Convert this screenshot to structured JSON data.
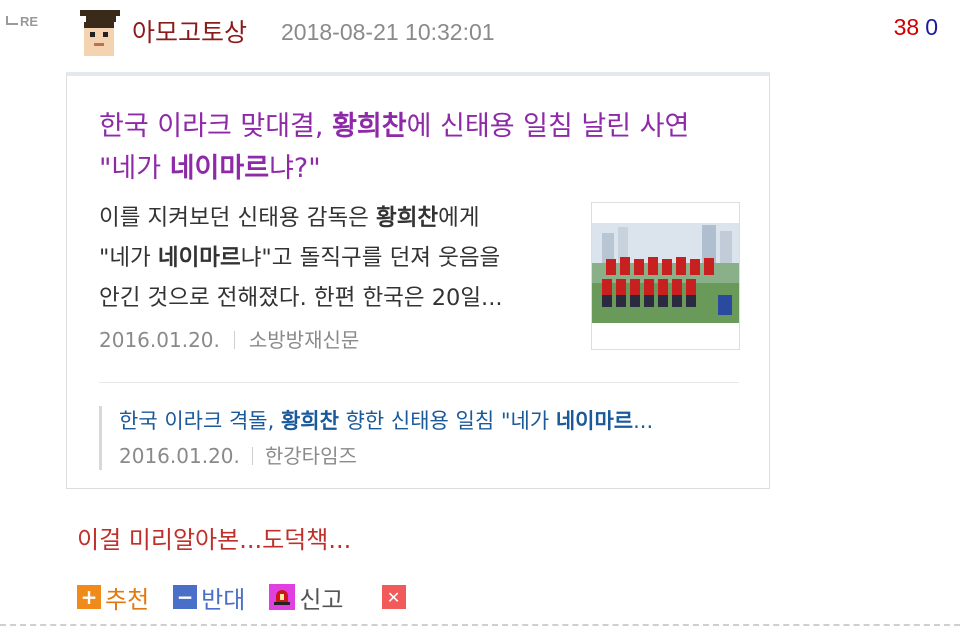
{
  "comment": {
    "re_label": "RE",
    "username": "아모고토상",
    "timestamp": "2018-08-21 10:32:01",
    "votes_up": "38",
    "votes_down": "0",
    "text": "이걸 미리알아본...도덕책..."
  },
  "card": {
    "title_pre": "한국 이라크 맞대결, ",
    "title_bold1": "황희찬",
    "title_mid": "에 신태용 일침 날린 사연",
    "title_line2_pre": "\"네가 ",
    "title_bold2": "네이마르",
    "title_line2_post": "냐?\"",
    "summary_1": "이를 지켜보던 신태용 감독은 ",
    "summary_b1": "황희찬",
    "summary_2": "에게",
    "summary_3": "\"네가 ",
    "summary_b2": "네이마르",
    "summary_4": "냐\"고 돌직구를 던져 웃음을",
    "summary_5": "안긴 것으로 전해졌다. 한편 한국은 20일...",
    "date": "2016.01.20.",
    "source": "소방방재신문"
  },
  "related": {
    "pre": "한국 이라크 격돌, ",
    "b1": "황희찬",
    "mid": " 향한 신태용 일침 \"네가 ",
    "b2": "네이마르",
    "post": "...",
    "date": "2016.01.20.",
    "source": "한강타임즈"
  },
  "actions": {
    "recommend": "추천",
    "oppose": "반대",
    "report": "신고"
  },
  "colors": {
    "username": "#8b1a1a",
    "title": "#8e2aa8",
    "related": "#1a5a9a",
    "comment": "#c0302a",
    "recommend": "#f08a1a",
    "oppose": "#4a6fc8",
    "report": "#e040e0",
    "delete": "#f05a5a"
  },
  "icons": [
    "reply-arrow-icon",
    "avatar-icon",
    "plus-icon",
    "minus-icon",
    "siren-icon",
    "close-icon"
  ]
}
